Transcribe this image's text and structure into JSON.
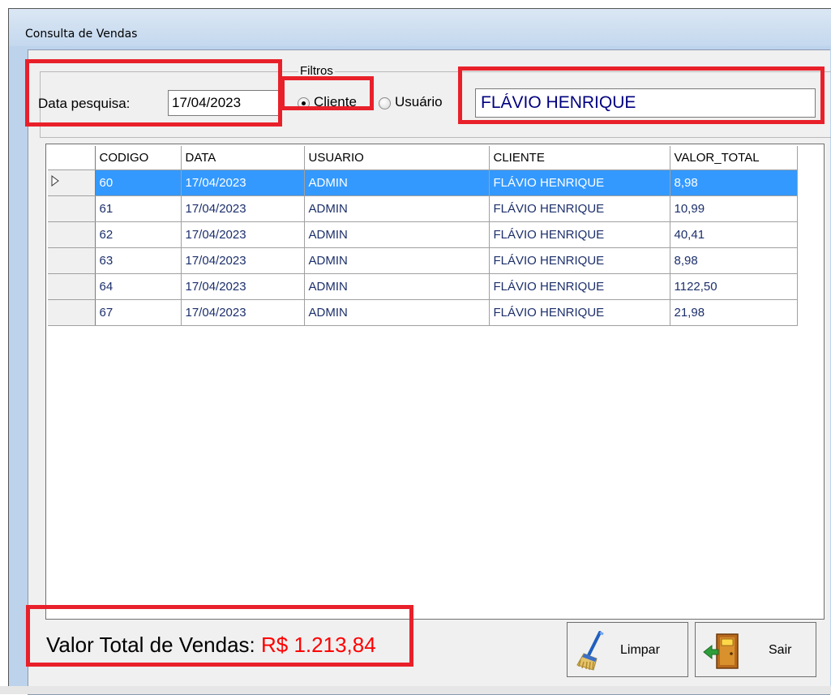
{
  "window": {
    "title": "Consulta de Vendas"
  },
  "filters": {
    "legend": "Filtros",
    "date_label": "Data pesquisa:",
    "date_value": "17/04/2023",
    "radio_cliente": "Cliente",
    "radio_usuario": "Usuário",
    "selected": "Cliente",
    "search_value": "FLÁVIO HENRIQUE"
  },
  "grid": {
    "columns": [
      "CODIGO",
      "DATA",
      "USUARIO",
      "CLIENTE",
      "VALOR_TOTAL"
    ],
    "rows": [
      [
        "60",
        "17/04/2023",
        "ADMIN",
        "FLÁVIO HENRIQUE",
        "8,98"
      ],
      [
        "61",
        "17/04/2023",
        "ADMIN",
        "FLÁVIO HENRIQUE",
        "10,99"
      ],
      [
        "62",
        "17/04/2023",
        "ADMIN",
        "FLÁVIO HENRIQUE",
        "40,41"
      ],
      [
        "63",
        "17/04/2023",
        "ADMIN",
        "FLÁVIO HENRIQUE",
        "8,98"
      ],
      [
        "64",
        "17/04/2023",
        "ADMIN",
        "FLÁVIO HENRIQUE",
        "1122,50"
      ],
      [
        "67",
        "17/04/2023",
        "ADMIN",
        "FLÁVIO HENRIQUE",
        "21,98"
      ]
    ],
    "selected_row": 0
  },
  "footer": {
    "total_label": "Valor Total de Vendas:",
    "total_value": "R$ 1.213,84",
    "clear_button": "Limpar",
    "exit_button": "Sair",
    "clear_icon": "broom-icon",
    "exit_icon": "exit-door-icon"
  },
  "colors": {
    "highlight": "#e8202a",
    "selection": "#3399ff",
    "total_value": "#ff0000",
    "search_text": "#000080"
  }
}
